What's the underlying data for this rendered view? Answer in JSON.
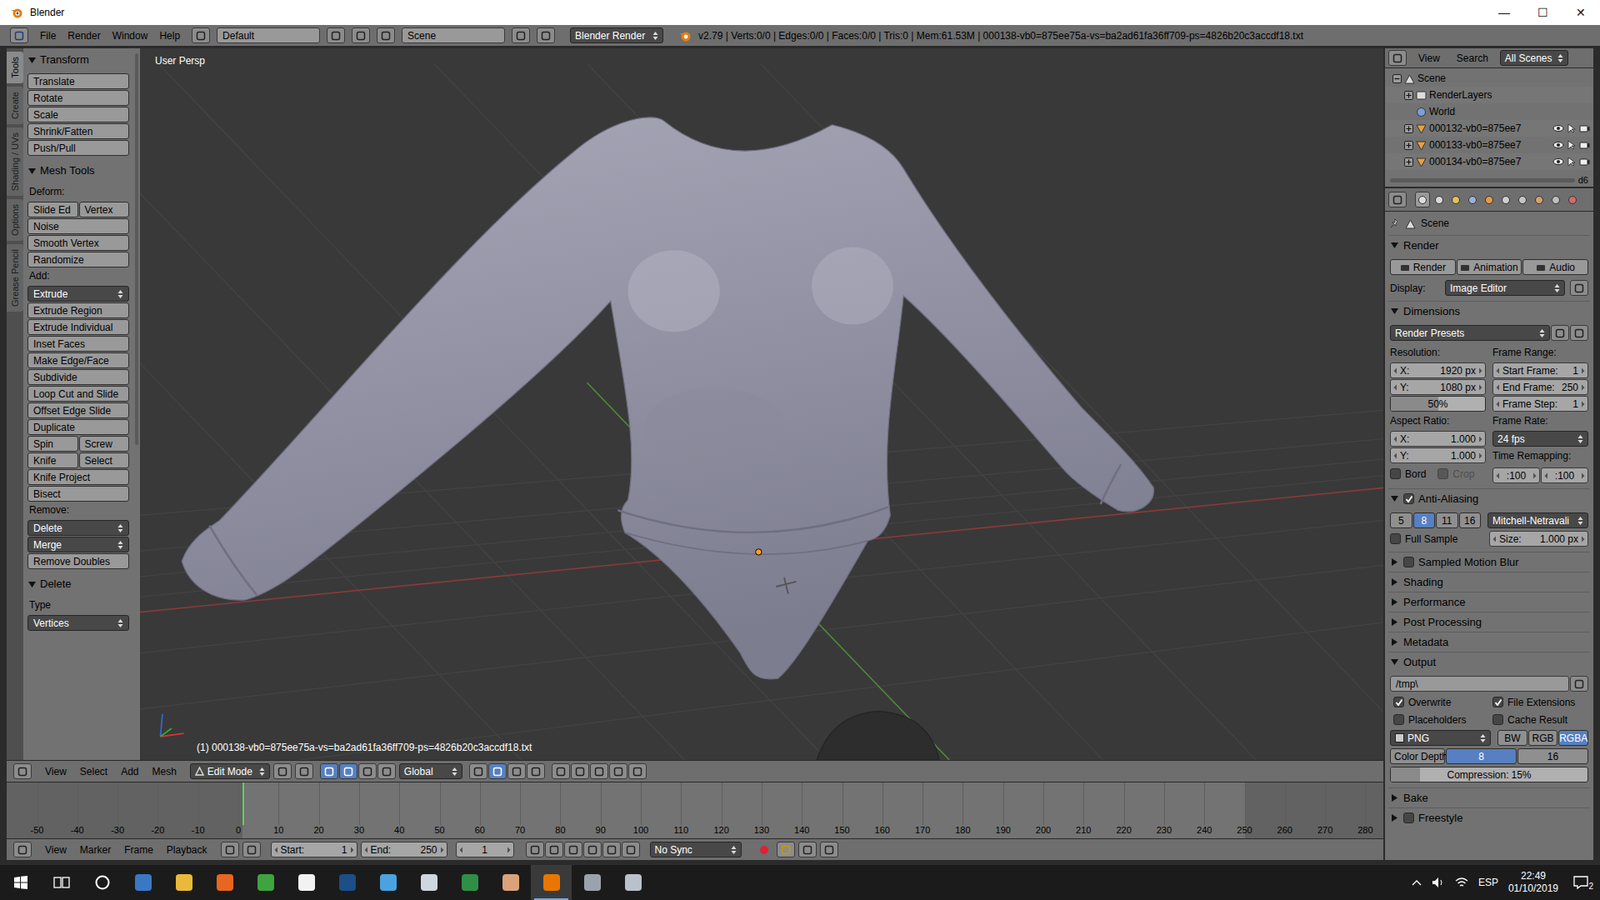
{
  "window": {
    "title": "Blender",
    "controls": [
      "—",
      "☐",
      "✕"
    ]
  },
  "info_header": {
    "menus": [
      "File",
      "Render",
      "Window",
      "Help"
    ],
    "layout": "Default",
    "scene": "Scene",
    "engine": "Blender Render",
    "stats": "v2.79 | Verts:0/0 | Edges:0/0 | Faces:0/0 | Tris:0 | Mem:61.53M | 000138-vb0=875ee75a-vs=ba2ad61fa36ff709-ps=4826b20c3accdf18.txt"
  },
  "tool_shelf": {
    "tabs": [
      {
        "label": "Tools",
        "selected": true
      },
      {
        "label": "Create",
        "selected": false
      },
      {
        "label": "Shading / UVs",
        "selected": false
      },
      {
        "label": "Options",
        "selected": false
      },
      {
        "label": "Grease Pencil",
        "selected": false
      }
    ],
    "panels": [
      {
        "title": "Transform",
        "expanded": true,
        "items": [
          {
            "kind": "row",
            "buttons": [
              {
                "text": "Translate",
                "kind": "button"
              }
            ]
          },
          {
            "kind": "row",
            "buttons": [
              {
                "text": "Rotate",
                "kind": "button"
              }
            ]
          },
          {
            "kind": "row",
            "buttons": [
              {
                "text": "Scale",
                "kind": "button"
              }
            ]
          },
          {
            "kind": "row",
            "buttons": [
              {
                "text": "Shrink/Fatten",
                "kind": "button"
              }
            ]
          },
          {
            "kind": "row",
            "buttons": [
              {
                "text": "Push/Pull",
                "kind": "button"
              }
            ]
          }
        ]
      },
      {
        "title": "Mesh Tools",
        "expanded": true,
        "items": [
          {
            "kind": "label",
            "text": "Deform:"
          },
          {
            "kind": "row",
            "buttons": [
              {
                "text": "Slide Ed",
                "kind": "button"
              },
              {
                "text": "Vertex",
                "kind": "button"
              }
            ]
          },
          {
            "kind": "row",
            "buttons": [
              {
                "text": "Noise",
                "kind": "button"
              }
            ]
          },
          {
            "kind": "row",
            "buttons": [
              {
                "text": "Smooth Vertex",
                "kind": "button"
              }
            ]
          },
          {
            "kind": "row",
            "buttons": [
              {
                "text": "Randomize",
                "kind": "button"
              }
            ]
          },
          {
            "kind": "label",
            "text": "Add:"
          },
          {
            "kind": "row",
            "buttons": [
              {
                "text": "Extrude",
                "kind": "dropdown"
              }
            ]
          },
          {
            "kind": "row",
            "buttons": [
              {
                "text": "Extrude Region",
                "kind": "button"
              }
            ]
          },
          {
            "kind": "row",
            "buttons": [
              {
                "text": "Extrude Individual",
                "kind": "button"
              }
            ]
          },
          {
            "kind": "row",
            "buttons": [
              {
                "text": "Inset Faces",
                "kind": "button"
              }
            ]
          },
          {
            "kind": "row",
            "buttons": [
              {
                "text": "Make Edge/Face",
                "kind": "button"
              }
            ]
          },
          {
            "kind": "row",
            "buttons": [
              {
                "text": "Subdivide",
                "kind": "button"
              }
            ]
          },
          {
            "kind": "row",
            "buttons": [
              {
                "text": "Loop Cut and Slide",
                "kind": "button"
              }
            ]
          },
          {
            "kind": "row",
            "buttons": [
              {
                "text": "Offset Edge Slide",
                "kind": "button"
              }
            ]
          },
          {
            "kind": "row",
            "buttons": [
              {
                "text": "Duplicate",
                "kind": "button"
              }
            ]
          },
          {
            "kind": "row",
            "buttons": [
              {
                "text": "Spin",
                "kind": "button"
              },
              {
                "text": "Screw",
                "kind": "button"
              }
            ]
          },
          {
            "kind": "row",
            "buttons": [
              {
                "text": "Knife",
                "kind": "button"
              },
              {
                "text": "Select",
                "kind": "button"
              }
            ]
          },
          {
            "kind": "row",
            "buttons": [
              {
                "text": "Knife Project",
                "kind": "button"
              }
            ]
          },
          {
            "kind": "row",
            "buttons": [
              {
                "text": "Bisect",
                "kind": "button"
              }
            ]
          },
          {
            "kind": "label",
            "text": "Remove:"
          },
          {
            "kind": "row",
            "buttons": [
              {
                "text": "Delete",
                "kind": "dropdown"
              }
            ]
          },
          {
            "kind": "row",
            "buttons": [
              {
                "text": "Merge",
                "kind": "dropdown"
              }
            ]
          },
          {
            "kind": "row",
            "buttons": [
              {
                "text": "Remove Doubles",
                "kind": "button"
              }
            ]
          }
        ]
      },
      {
        "title": "Delete",
        "expanded": true,
        "items": [
          {
            "kind": "label",
            "text": "Type"
          },
          {
            "kind": "row",
            "buttons": [
              {
                "text": "Vertices",
                "kind": "dropdown"
              }
            ]
          }
        ]
      }
    ]
  },
  "viewport": {
    "view_name": "User Persp",
    "object_info": "(1) 000138-vb0=875ee75a-vs=ba2ad61fa36ff709-ps=4826b20c3accdf18.txt"
  },
  "viewport_header": {
    "menus": [
      "View",
      "Select",
      "Add",
      "Mesh"
    ],
    "mode": "Edit Mode",
    "orientation": "Global"
  },
  "timeline": {
    "ticks": [
      "-50",
      "-40",
      "-30",
      "-20",
      "-10",
      "0",
      "10",
      "20",
      "30",
      "40",
      "50",
      "60",
      "70",
      "80",
      "90",
      "100",
      "110",
      "120",
      "130",
      "140",
      "150",
      "160",
      "170",
      "180",
      "190",
      "200",
      "210",
      "220",
      "230",
      "240",
      "250",
      "260",
      "270",
      "280"
    ],
    "menus": [
      "View",
      "Marker",
      "Frame",
      "Playback"
    ],
    "start_label": "Start:",
    "start": "1",
    "end_label": "End:",
    "end": "250",
    "current": "1",
    "sync": "No Sync"
  },
  "outliner": {
    "menus": [
      "View",
      "Search"
    ],
    "filter": "All Scenes",
    "items": [
      {
        "label": "Scene",
        "kind": "scene",
        "depth": 0,
        "expanded": true
      },
      {
        "label": "RenderLayers",
        "kind": "renderlayers",
        "depth": 1,
        "expanded": false
      },
      {
        "label": "World",
        "kind": "world",
        "depth": 1
      },
      {
        "label": "000132-vb0=875ee7",
        "kind": "mesh",
        "depth": 1,
        "expanded": false,
        "visible": true,
        "selectable": true,
        "renderable": true
      },
      {
        "label": "000133-vb0=875ee7",
        "kind": "mesh",
        "depth": 1,
        "expanded": false,
        "visible": true,
        "selectable": true,
        "renderable": true
      },
      {
        "label": "000134-vb0=875ee7",
        "kind": "mesh",
        "depth": 1,
        "expanded": false,
        "visible": true,
        "selectable": true,
        "renderable": true
      }
    ],
    "overflow_text": "d6"
  },
  "properties": {
    "tabs": [
      {
        "selected": true
      },
      {
        "selected": false
      },
      {
        "selected": false
      },
      {
        "selected": false
      },
      {
        "selected": false
      },
      {
        "selected": false
      },
      {
        "selected": false
      },
      {
        "selected": false
      },
      {
        "selected": false
      },
      {
        "selected": false
      }
    ],
    "context": "Scene",
    "render": {
      "title": "Render",
      "expanded": true,
      "buttons": [
        "Render",
        "Animation",
        "Audio"
      ],
      "display_label": "Display:",
      "display": "Image Editor"
    },
    "dimensions": {
      "title": "Dimensions",
      "expanded": true,
      "presets": "Render Presets",
      "resolution": {
        "label": "Resolution:",
        "fields": [
          {
            "label": "X:",
            "value": "1920 px"
          },
          {
            "label": "Y:",
            "value": "1080 px"
          }
        ],
        "percent": {
          "value": "50%",
          "level": 0.5
        }
      },
      "frame_range": {
        "label": "Frame Range:",
        "fields": [
          {
            "label": "Start Frame:",
            "value": "1"
          },
          {
            "label": "End Frame:",
            "value": "250"
          },
          {
            "label": "Frame Step:",
            "value": "1"
          }
        ]
      },
      "aspect": {
        "label": "Aspect Ratio:",
        "fields": [
          {
            "label": "X:",
            "value": "1.000"
          },
          {
            "label": "Y:",
            "value": "1.000"
          }
        ]
      },
      "frame_rate": {
        "label": "Frame Rate:",
        "value": "24 fps"
      },
      "border": {
        "label": "Bord",
        "checked": false
      },
      "crop": {
        "label": "Crop",
        "checked": false,
        "disabled": true
      },
      "time_remapping": {
        "label": "Time Remapping:",
        "old": ":100",
        "new": ":100"
      }
    },
    "anti_aliasing": {
      "title": "Anti-Aliasing",
      "enabled": true,
      "expanded": true,
      "samples": [
        {
          "label": "5",
          "selected": false
        },
        {
          "label": "8",
          "selected": true
        },
        {
          "label": "11",
          "selected": false
        },
        {
          "label": "16",
          "selected": false
        }
      ],
      "filter": "Mitchell-Netravali",
      "full_sample": {
        "label": "Full Sample",
        "checked": false
      },
      "size": {
        "label": "Size:",
        "value": "1.000 px"
      }
    },
    "more_panels": [
      {
        "title": "Sampled Motion Blur",
        "kind": "checkbox",
        "checked": false,
        "expanded": false
      },
      {
        "title": "Shading",
        "kind": "plain",
        "expanded": false
      },
      {
        "title": "Performance",
        "kind": "plain",
        "expanded": false
      },
      {
        "title": "Post Processing",
        "kind": "plain",
        "expanded": false
      },
      {
        "title": "Metadata",
        "kind": "plain",
        "expanded": false
      }
    ],
    "output": {
      "title": "Output",
      "expanded": true,
      "path": "/tmp\\",
      "options": [
        {
          "label": "Overwrite",
          "checked": true
        },
        {
          "label": "File Extensions",
          "checked": true
        },
        {
          "label": "Placeholders",
          "checked": false
        },
        {
          "label": "Cache Result",
          "checked": false
        }
      ],
      "format": "PNG",
      "channels": [
        {
          "label": "BW",
          "selected": false
        },
        {
          "label": "RGB",
          "selected": false
        },
        {
          "label": "RGBA",
          "selected": true
        }
      ],
      "color_depth_label": "Color Depth:",
      "depths": [
        {
          "label": "8",
          "selected": true
        },
        {
          "label": "16",
          "selected": false
        }
      ],
      "compression": {
        "label": "Compression:",
        "value": "15%",
        "level": 0.15
      }
    },
    "end_panels": [
      {
        "title": "Bake",
        "kind": "plain",
        "expanded": false
      },
      {
        "title": "Freestyle",
        "kind": "checkbox",
        "checked": false,
        "expanded": false
      }
    ]
  },
  "taskbar": {
    "apps": [
      {
        "kind": "start",
        "color": "#ffffff",
        "selected": false
      },
      {
        "kind": "taskview",
        "color": "#ffffff",
        "selected": false
      },
      {
        "kind": "search",
        "color": "#ffffff",
        "selected": false
      },
      {
        "kind": "app",
        "color": "#3b78c4",
        "selected": false
      },
      {
        "kind": "app",
        "color": "#e8b93a",
        "selected": false
      },
      {
        "kind": "app",
        "color": "#e8661f",
        "selected": false
      },
      {
        "kind": "app",
        "color": "#3fa33f",
        "selected": false
      },
      {
        "kind": "app",
        "color": "#f2f2f2",
        "selected": false
      },
      {
        "kind": "app",
        "color": "#1b4f86",
        "selected": false
      },
      {
        "kind": "app",
        "color": "#4aa3df",
        "selected": false
      },
      {
        "kind": "app",
        "color": "#cfd6dd",
        "selected": false
      },
      {
        "kind": "app",
        "color": "#2f8f46",
        "selected": false
      },
      {
        "kind": "app",
        "color": "#d9a27a",
        "selected": false
      },
      {
        "kind": "app",
        "color": "#ea7600",
        "selected": true
      },
      {
        "kind": "app",
        "color": "#9aa3ab",
        "selected": false
      },
      {
        "kind": "app",
        "color": "#b9c2cb",
        "selected": false
      }
    ],
    "language": "ESP",
    "time": "22:49",
    "date": "01/10/2019",
    "notifications": "2"
  }
}
